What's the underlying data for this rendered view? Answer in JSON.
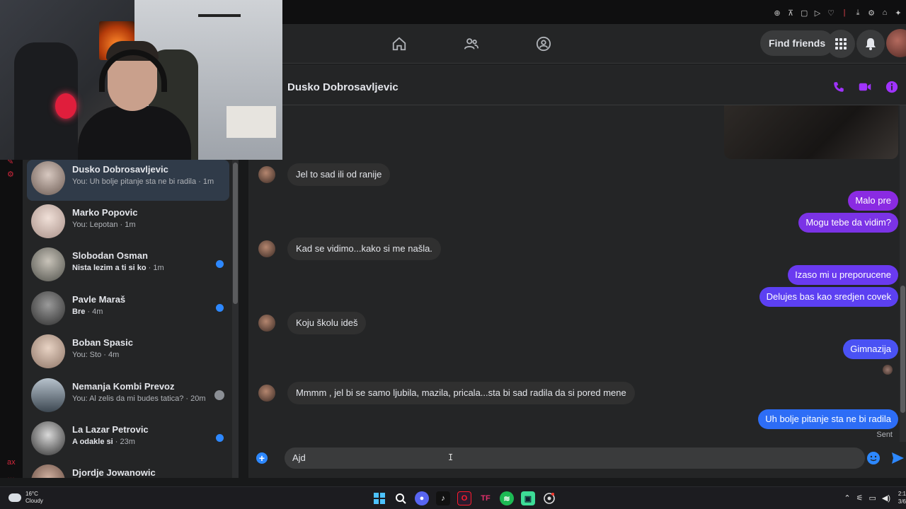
{
  "header": {
    "find_friends": "Find friends"
  },
  "conversation": {
    "title": "Dusko Dobrosavljevic",
    "messages_in": [
      "Jel to sad ili od ranije",
      "Kad se vidimo...kako si me našla.",
      "Koju školu ideš",
      "Mmmm , jel bi se samo ljubila, mazila, pricala...sta bi sad radila da si pored mene"
    ],
    "messages_out": [
      "Malo pre",
      "Mogu tebe da vidim?",
      "Izaso mi u preporucene",
      "Delujes bas kao sredjen covek",
      "Gimnazija",
      "Uh bolje pitanje sta ne bi radila"
    ],
    "sent_status": "Sent",
    "composer_value": "Ajd"
  },
  "chats": [
    {
      "name": "Dusko Dobrosavljevic",
      "preview": "You: Uh bolje pitanje sta ne bi radila",
      "time": "1m",
      "unread": false,
      "active": true
    },
    {
      "name": "Marko Popovic",
      "preview": "You: Lepotan",
      "time": "1m",
      "unread": false,
      "active": false
    },
    {
      "name": "Slobodan Osman",
      "preview": "Nista lezim a ti si ko",
      "time": "1m",
      "unread": true,
      "active": false
    },
    {
      "name": "Pavle Maraš",
      "preview": "Bre",
      "time": "4m",
      "unread": true,
      "active": false
    },
    {
      "name": "Boban Spasic",
      "preview": "You: Sto",
      "time": "4m",
      "unread": false,
      "active": false
    },
    {
      "name": "Nemanja Kombi Prevoz",
      "preview": "You: Al zelis da mi budes tatica?",
      "time": "20m",
      "unread": false,
      "active": false
    },
    {
      "name": "La Lazar Petrovic",
      "preview": "A odakle si",
      "time": "23m",
      "unread": true,
      "active": false
    },
    {
      "name": "Djordje Jowanowic",
      "preview": "",
      "time": "",
      "unread": false,
      "active": false
    }
  ],
  "taskbar": {
    "temp": "16°C",
    "weather": "Cloudy",
    "clock_time": "2:1",
    "clock_date": "3/6"
  },
  "colors": {
    "bubble_purple": "#8a2be2",
    "bubble_blue": "#2d6df6",
    "accent": "#2d88ff"
  }
}
